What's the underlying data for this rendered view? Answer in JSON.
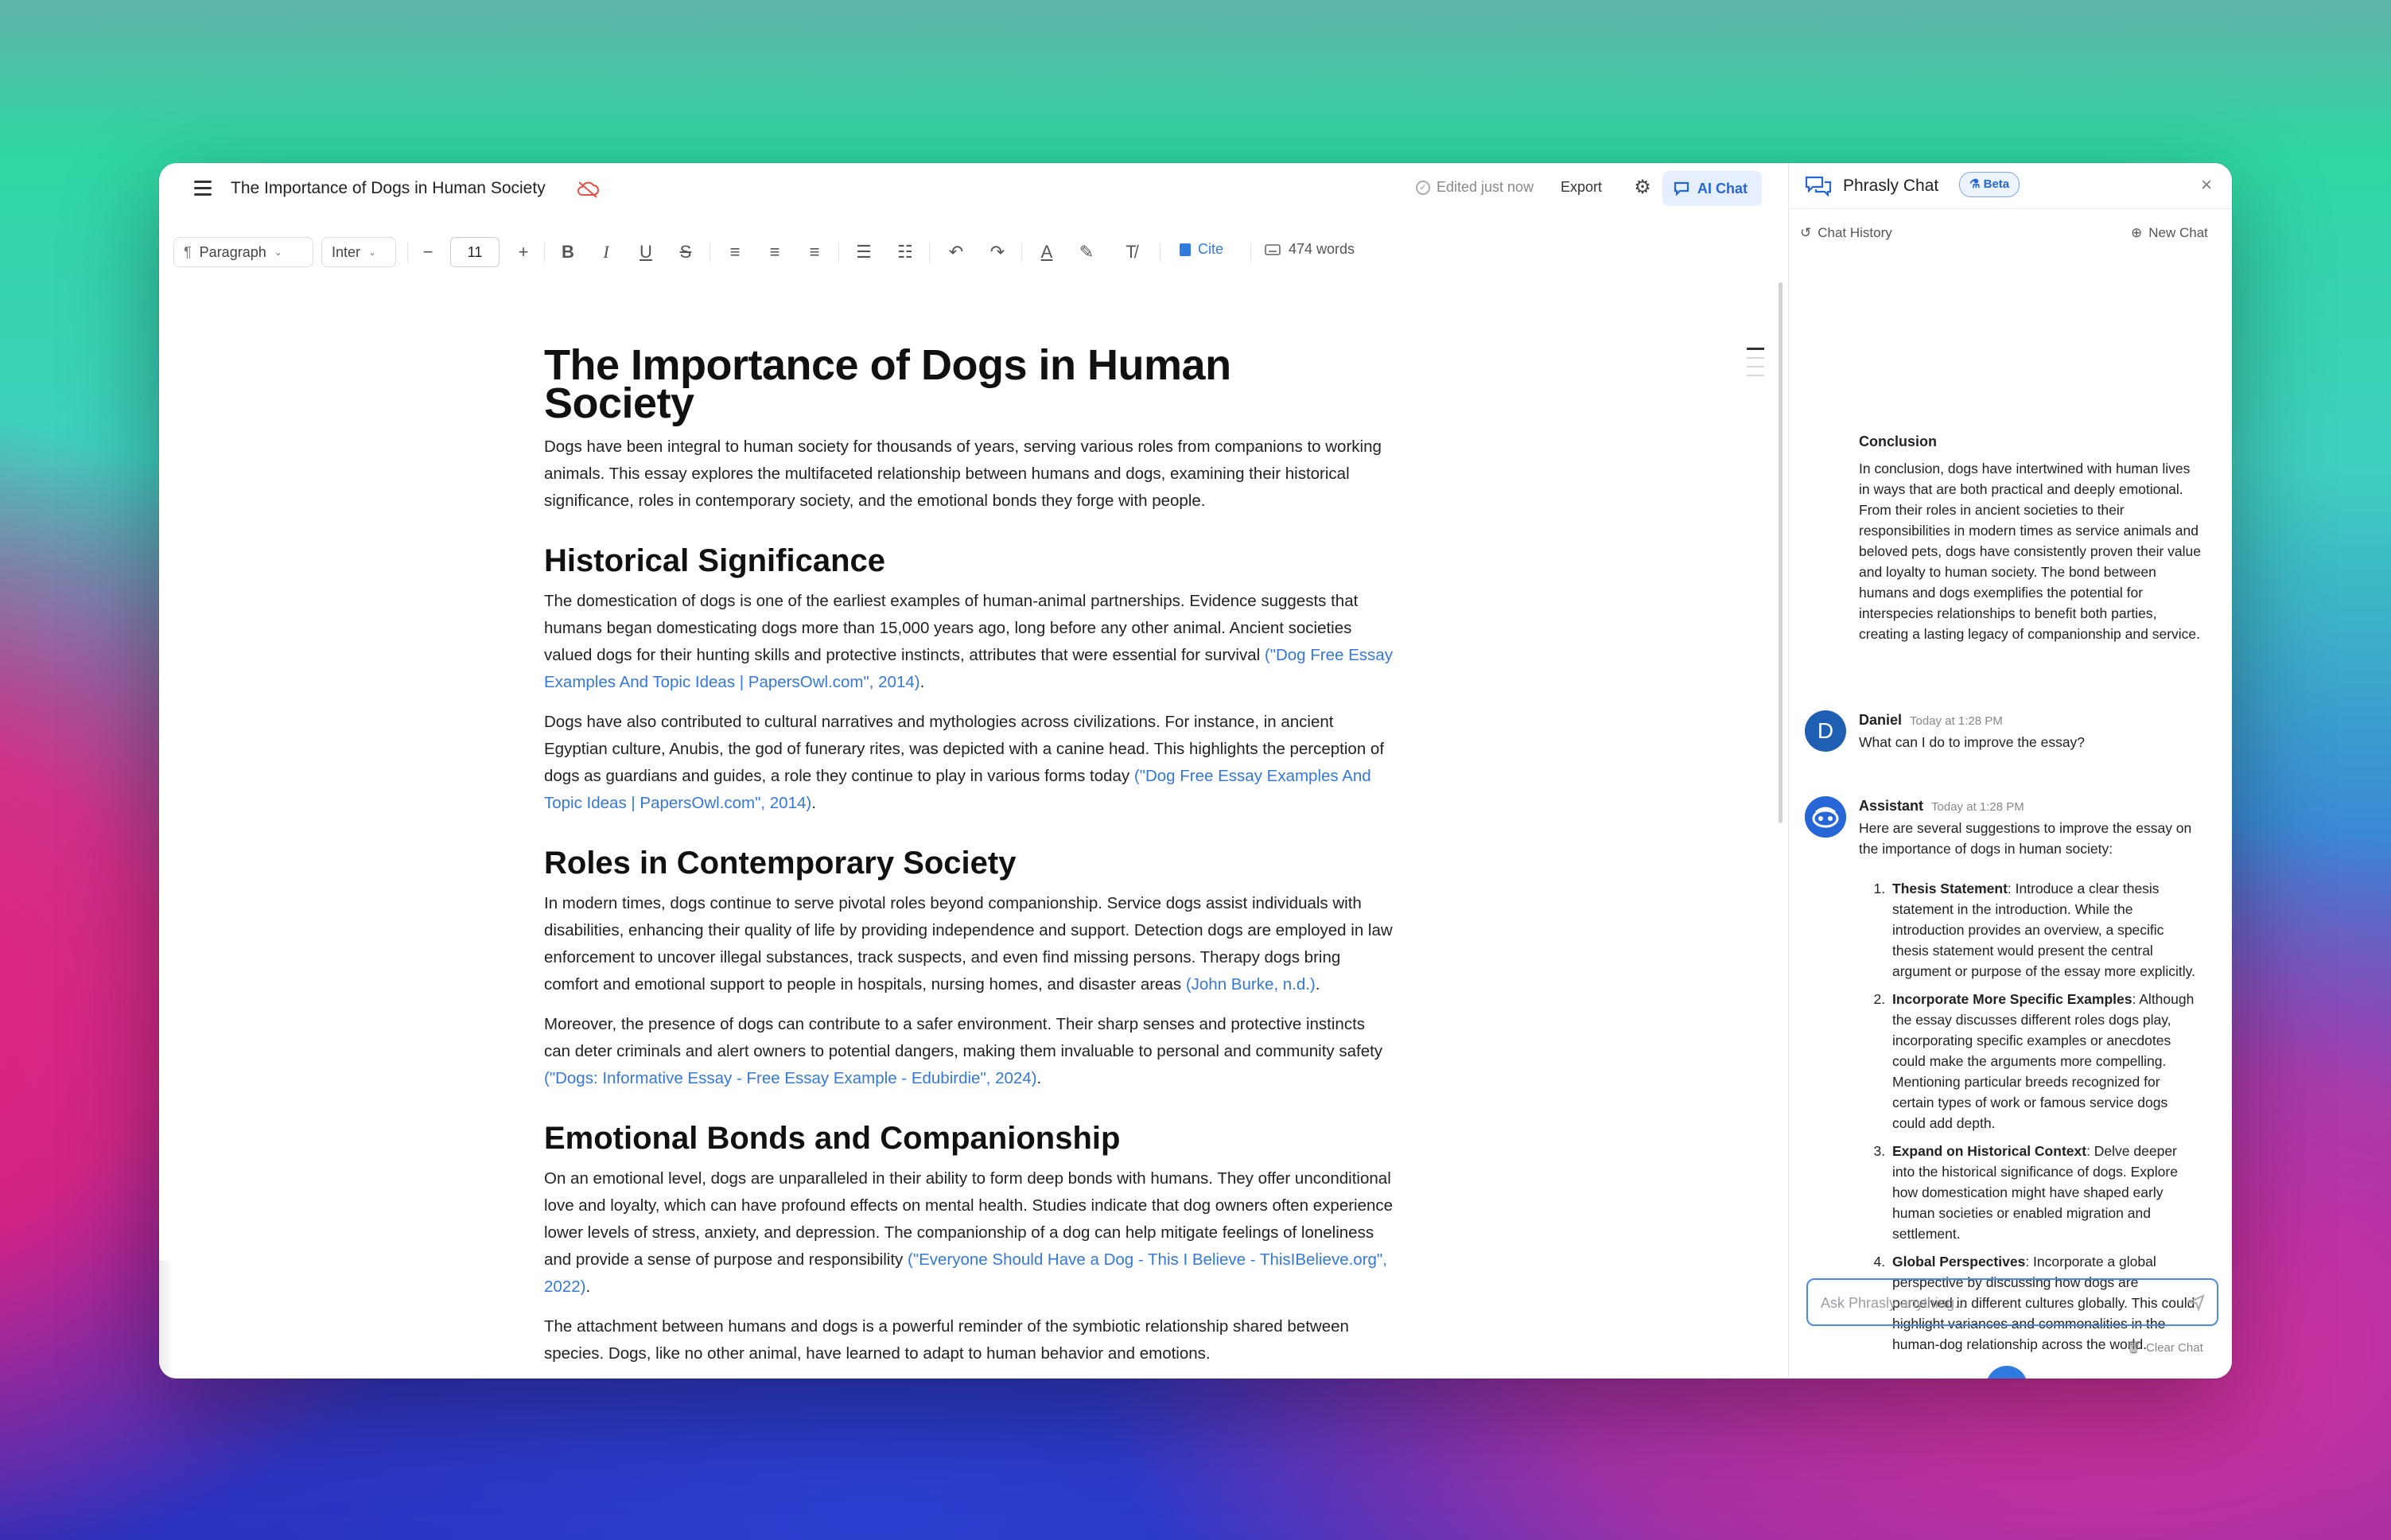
{
  "editor": {
    "doc_title": "The Importance of Dogs in Human Society",
    "status": "Edited just now",
    "export_label": "Export",
    "ai_chat_label": "AI Chat"
  },
  "toolbar": {
    "paragraph_label": "Paragraph",
    "font_label": "Inter",
    "font_size": "11",
    "cite_label": "Cite",
    "word_count": "474 words"
  },
  "document": {
    "title": "The Importance of Dogs in Human Society",
    "intro": "Dogs have been integral to human society for thousands of years, serving various roles from companions to working animals. This essay explores the multifaceted relationship between humans and dogs, examining their historical significance, roles in contemporary society, and the emotional bonds they forge with people.",
    "sections": [
      {
        "heading": "Historical Significance",
        "paragraphs": [
          {
            "text": "The domestication of dogs is one of the earliest examples of human-animal partnerships. Evidence suggests that humans began domesticating dogs more than 15,000 years ago, long before any other animal. Ancient societies valued dogs for their hunting skills and protective instincts, attributes that were essential for survival ",
            "cite": "(\"Dog Free Essay Examples And Topic Ideas | PapersOwl.com\", 2014)",
            "end": "."
          },
          {
            "text": "Dogs have also contributed to cultural narratives and mythologies across civilizations. For instance, in ancient Egyptian culture, Anubis, the god of funerary rites, was depicted with a canine head. This highlights the perception of dogs as guardians and guides, a role they continue to play in various forms today ",
            "cite": "(\"Dog Free Essay Examples And Topic Ideas | PapersOwl.com\", 2014)",
            "end": "."
          }
        ]
      },
      {
        "heading": "Roles in Contemporary Society",
        "paragraphs": [
          {
            "text": "In modern times, dogs continue to serve pivotal roles beyond companionship. Service dogs assist individuals with disabilities, enhancing their quality of life by providing independence and support. Detection dogs are employed in law enforcement to uncover illegal substances, track suspects, and even find missing persons. Therapy dogs bring comfort and emotional support to people in hospitals, nursing homes, and disaster areas ",
            "cite": "(John Burke, n.d.)",
            "end": "."
          },
          {
            "text": "Moreover, the presence of dogs can contribute to a safer environment. Their sharp senses and protective instincts can deter criminals and alert owners to potential dangers, making them invaluable to personal and community safety ",
            "cite": "(\"Dogs: Informative Essay - Free Essay Example - Edubirdie\", 2024)",
            "end": "."
          }
        ]
      },
      {
        "heading": "Emotional Bonds and Companionship",
        "paragraphs": [
          {
            "text": "On an emotional level, dogs are unparalleled in their ability to form deep bonds with humans. They offer unconditional love and loyalty, which can have profound effects on mental health. Studies indicate that dog owners often experience lower levels of stress, anxiety, and depression. The companionship of a dog can help mitigate feelings of loneliness and provide a sense of purpose and responsibility ",
            "cite": "(\"Everyone Should Have a Dog - This I Believe - ThisIBelieve.org\", 2022)",
            "end": "."
          },
          {
            "text": "The attachment between humans and dogs is a powerful reminder of the symbiotic relationship shared between species. Dogs, like no other animal, have learned to adapt to human behavior and emotions.",
            "cite": "",
            "end": ""
          }
        ]
      }
    ]
  },
  "chat": {
    "title": "Phrasly Chat",
    "beta_label": "Beta",
    "history_label": "Chat History",
    "new_chat_label": "New Chat",
    "conclusion_title": "Conclusion",
    "conclusion_text": "In conclusion, dogs have intertwined with human lives in ways that are both practical and deeply emotional. From their roles in ancient societies to their responsibilities in modern times as service animals and beloved pets, dogs have consistently proven their value and loyalty to human society. The bond between humans and dogs exemplifies the potential for interspecies relationships to benefit both parties, creating a lasting legacy of companionship and service.",
    "user": {
      "initial": "D",
      "name": "Daniel",
      "time": "Today at 1:28 PM",
      "text": "What can I do to improve the essay?"
    },
    "assistant": {
      "name": "Assistant",
      "time": "Today at 1:28 PM",
      "intro": "Here are several suggestions to improve the essay on the importance of dogs in human society:",
      "suggestions": [
        {
          "title": "Thesis Statement",
          "text": ": Introduce a clear thesis statement in the introduction. While the introduction provides an overview, a specific thesis statement would present the central argument or purpose of the essay more explicitly."
        },
        {
          "title": "Incorporate More Specific Examples",
          "text": ": Although the essay discusses different roles dogs play, incorporating specific examples or anecdotes could make the arguments more compelling. Mentioning particular breeds recognized for certain types of work or famous service dogs could add depth."
        },
        {
          "title": "Expand on Historical Context",
          "text": ": Delve deeper into the historical significance of dogs. Explore how domestication might have shaped early human societies or enabled migration and settlement."
        },
        {
          "title": "Global Perspectives",
          "text": ": Incorporate a global perspective by discussing how dogs are perceived in different cultures globally. This could highlight variances and commonalities in the human-dog relationship across the world."
        }
      ]
    },
    "input_placeholder": "Ask Phrasly anything...",
    "clear_label": "Clear Chat"
  }
}
